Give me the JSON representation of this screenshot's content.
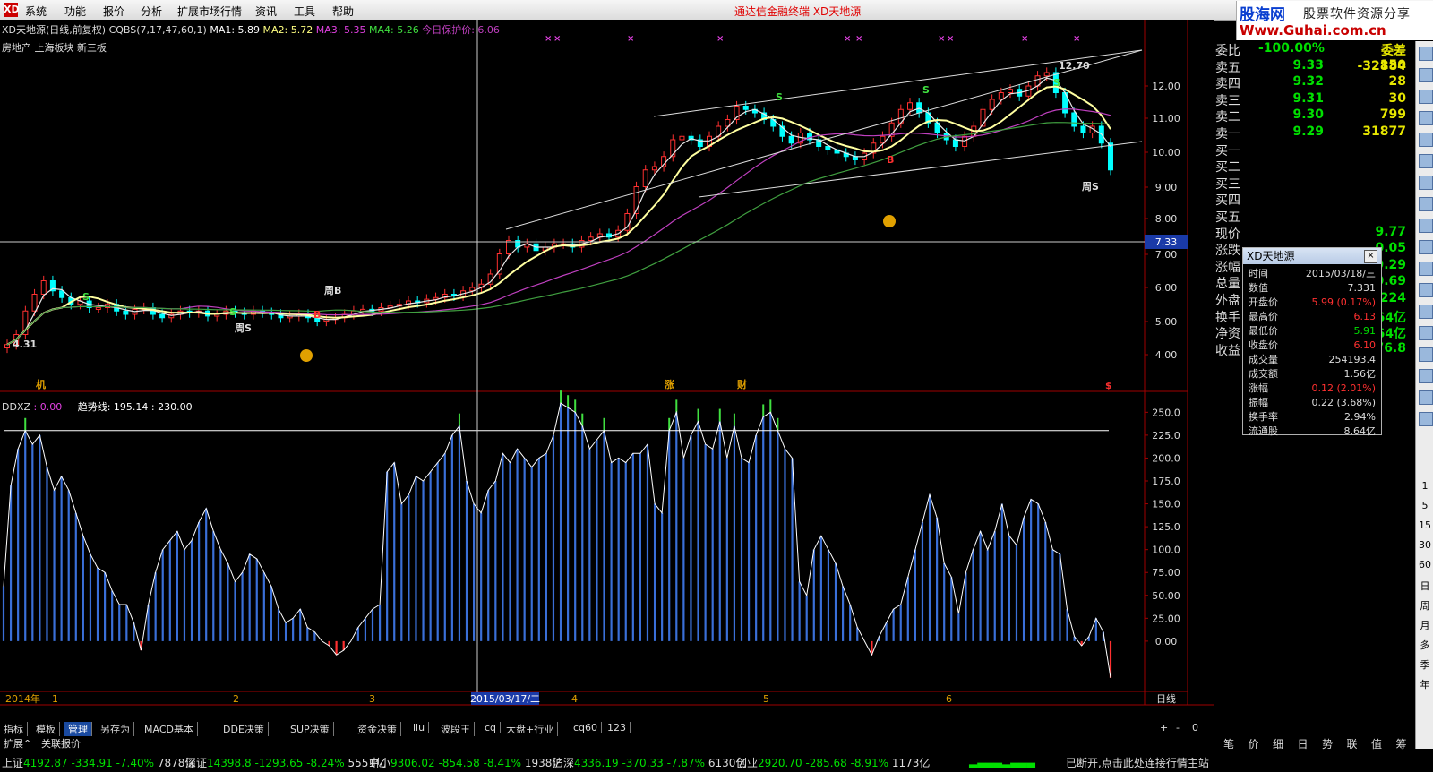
{
  "menu": {
    "logo": "XD",
    "items": [
      "系统",
      "功能",
      "报价",
      "分析",
      "扩展市场行情",
      "资讯",
      "工具",
      "帮助"
    ],
    "center_title": "通达信金融终端  XD天地源"
  },
  "brand": {
    "name": "股海网",
    "tagline": "股票软件资源分享",
    "url": "Www.Guhai.com.cn"
  },
  "main_header": {
    "title": "XD天地源(日线,前复权)",
    "cqbs": "CQBS(7,17,47,60,1)",
    "ma1": "MA1: 5.89",
    "ma2": "MA2: 5.72",
    "ma3": "MA3: 5.35",
    "ma4": "MA4: 5.26",
    "protect": "今日保护价: 6.06",
    "sectors": "房地产 上海板块 新三板"
  },
  "chart_labels": {
    "peak": "12.70",
    "low_val": "4.31",
    "week_b": "周B",
    "week_s1": "周S",
    "week_s2": "周S",
    "s1": "S",
    "s2": "S",
    "s3": "S",
    "s4": "S",
    "s5": "S",
    "b1": "B",
    "b2": "B",
    "zhang": "涨",
    "cai": "财",
    "ji": "机",
    "dollar": "$"
  },
  "price_axis": [
    "12.00",
    "11.00",
    "10.00",
    "9.00",
    "8.00",
    "7.00",
    "6.00",
    "5.00",
    "4.00"
  ],
  "crosshair_price": "7.33",
  "indicator_header": {
    "name": "DDXZ",
    "val": ": 0.00",
    "trend": "趋势线: 195.14",
    "val2": ": 230.00"
  },
  "indicator_axis": [
    "250.0",
    "225.0",
    "200.0",
    "175.0",
    "150.0",
    "125.0",
    "100.0",
    "75.00",
    "50.00",
    "25.00",
    "0.00"
  ],
  "date_axis": {
    "year": "2014年",
    "months": [
      "1",
      "2",
      "3",
      "4",
      "5",
      "6"
    ],
    "cursor_date": "2015/03/17/二",
    "period": "日线"
  },
  "chart_data": {
    "type": "bar",
    "title": "DDXZ",
    "ylim": [
      -50,
      265
    ],
    "trend_line": 230,
    "values": [
      60,
      170,
      210,
      230,
      215,
      225,
      190,
      165,
      180,
      165,
      140,
      115,
      95,
      80,
      75,
      55,
      40,
      40,
      20,
      -10,
      40,
      75,
      100,
      110,
      120,
      100,
      110,
      130,
      145,
      120,
      100,
      85,
      65,
      75,
      95,
      90,
      75,
      60,
      35,
      20,
      25,
      35,
      15,
      10,
      0,
      -5,
      -15,
      -10,
      0,
      15,
      25,
      35,
      40,
      185,
      195,
      150,
      160,
      180,
      175,
      185,
      195,
      205,
      225,
      235,
      175,
      150,
      140,
      165,
      175,
      205,
      195,
      210,
      200,
      190,
      200,
      205,
      225,
      260,
      255,
      250,
      235,
      210,
      220,
      230,
      195,
      200,
      195,
      205,
      205,
      215,
      150,
      140,
      230,
      250,
      200,
      225,
      240,
      215,
      210,
      240,
      200,
      235,
      200,
      195,
      225,
      245,
      250,
      230,
      210,
      200,
      65,
      50,
      100,
      115,
      100,
      85,
      60,
      40,
      15,
      0,
      -15,
      5,
      20,
      35,
      40,
      70,
      100,
      130,
      160,
      135,
      85,
      70,
      30,
      75,
      100,
      120,
      100,
      120,
      150,
      115,
      105,
      135,
      155,
      150,
      130,
      100,
      95,
      35,
      5,
      -5,
      5,
      25,
      10,
      -40
    ]
  },
  "quote": [
    {
      "k": "委比",
      "p": "-100.00%",
      "v": "委差 -32884"
    },
    {
      "k": "卖五",
      "p": "9.33",
      "v": "150"
    },
    {
      "k": "卖四",
      "p": "9.32",
      "v": "28"
    },
    {
      "k": "卖三",
      "p": "9.31",
      "v": "30"
    },
    {
      "k": "卖二",
      "p": "9.30",
      "v": "799"
    },
    {
      "k": "卖一",
      "p": "9.29",
      "v": "31877"
    },
    {
      "k": "买一",
      "p": "",
      "v": ""
    },
    {
      "k": "买二",
      "p": "",
      "v": ""
    },
    {
      "k": "买三",
      "p": "",
      "v": ""
    },
    {
      "k": "买四",
      "p": "",
      "v": ""
    },
    {
      "k": "买五",
      "p": "",
      "v": ""
    },
    {
      "k": "现价",
      "p": "",
      "v": "9.77"
    },
    {
      "k": "涨跌",
      "p": "",
      "v": "0.05"
    },
    {
      "k": "涨幅",
      "p": "",
      "v": "9.29"
    },
    {
      "k": "总量",
      "p": "",
      "v": "0.69"
    },
    {
      "k": "外盘",
      "p": "",
      "v": "1224"
    },
    {
      "k": "换手",
      "p": "",
      "v": "64亿"
    },
    {
      "k": "净资",
      "p": "",
      "v": "64亿"
    },
    {
      "k": "收益",
      "p": "",
      "v": "76.8"
    }
  ],
  "popup": {
    "title": "XD天地源",
    "rows": [
      [
        "时间",
        "2015/03/18/三"
      ],
      [
        "数值",
        "7.331"
      ],
      [
        "开盘价",
        "5.99 (0.17%)"
      ],
      [
        "最高价",
        "6.13"
      ],
      [
        "最低价",
        "5.91"
      ],
      [
        "收盘价",
        "6.10"
      ],
      [
        "成交量",
        "254193.4"
      ],
      [
        "成交额",
        "1.56亿"
      ],
      [
        "涨幅",
        "0.12 (2.01%)"
      ],
      [
        "振幅",
        "0.22 (3.68%)"
      ],
      [
        "换手率",
        "2.94%"
      ],
      [
        "流通股",
        "8.64亿"
      ]
    ]
  },
  "toolbar_tabs": [
    "指标",
    "模板",
    "管理",
    "另存为",
    "MACD基本",
    "DDE决策",
    "SUP决策",
    "资金决策",
    "liu",
    "波段王",
    "cq",
    "大盘+行业",
    "cq60",
    "123"
  ],
  "zoom_btns": [
    "+",
    "-",
    "0"
  ],
  "ext_tabs": [
    "扩展^",
    "关联报价"
  ],
  "right_tabs": [
    "笔",
    "价",
    "细",
    "日",
    "势",
    "联",
    "值",
    "筹"
  ],
  "status": [
    {
      "name": "上证",
      "val": "4192.87",
      "chg": "-334.91",
      "pct": "-7.40%",
      "amt": "7878亿"
    },
    {
      "name": "深证",
      "val": "14398.8",
      "chg": "-1293.65",
      "pct": "-8.24%",
      "amt": "5551亿"
    },
    {
      "name": "中小",
      "val": "9306.02",
      "chg": "-854.58",
      "pct": "-8.41%",
      "amt": "1938亿"
    },
    {
      "name": "沪深",
      "val": "4336.19",
      "chg": "-370.33",
      "pct": "-7.87%",
      "amt": "6130亿"
    },
    {
      "name": "创业",
      "val": "2920.70",
      "chg": "-285.68",
      "pct": "-8.91%",
      "amt": "1173亿"
    }
  ],
  "status_msg": "已断开,点击此处连接行情主站",
  "icon_labels": [
    "1",
    "5",
    "15",
    "30",
    "60",
    "日",
    "周",
    "月",
    "多",
    "季",
    "年"
  ],
  "colors": {
    "up": "#ff3030",
    "down": "#00ffff",
    "ma_white": "#e8e8e8",
    "ma_yellow": "#ffffa0",
    "ma_magenta": "#c040c0",
    "ma_green": "#40a040",
    "bar_blue": "#3a6fd8"
  }
}
